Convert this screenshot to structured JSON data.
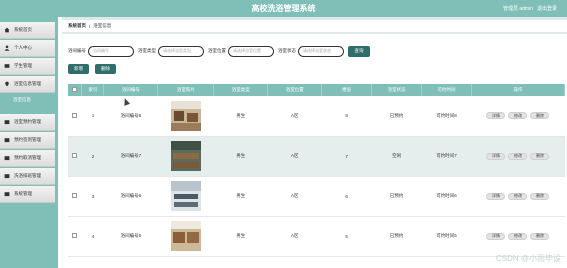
{
  "header": {
    "title": "高校洗浴管理系统",
    "user": "管理员 admin",
    "logout": "退出登录"
  },
  "sidebar": {
    "items": [
      {
        "label": "系统首页",
        "icon": "home-icon"
      },
      {
        "label": "个人中心",
        "icon": "user-icon"
      },
      {
        "label": "学生管理",
        "icon": "students-icon"
      },
      {
        "label": "浴室信息管理",
        "icon": "location-icon",
        "sub": "浴室信息"
      },
      {
        "label": "浴室预约管理",
        "icon": "folder-icon"
      },
      {
        "label": "预约签到管理",
        "icon": "folder-icon"
      },
      {
        "label": "预约取消管理",
        "icon": "folder-icon"
      },
      {
        "label": "洗浴排班管理",
        "icon": "folder-icon"
      },
      {
        "label": "系统管理",
        "icon": "folder-icon"
      }
    ]
  },
  "breadcrumb": {
    "home": "系统首页",
    "sep": "/",
    "current": "浴室信息"
  },
  "search": {
    "fields": [
      {
        "label": "浴间编号",
        "placeholder": "浴间编号"
      },
      {
        "label": "浴室类型",
        "placeholder": "请选择浴室类型"
      },
      {
        "label": "浴室位置",
        "placeholder": "请选择浴室位置"
      },
      {
        "label": "浴室状态",
        "placeholder": "请选择浴室状态"
      }
    ],
    "button": "查询"
  },
  "actions": {
    "add": "新增",
    "delete": "删除"
  },
  "table": {
    "headers": [
      "",
      "索引",
      "浴间编号",
      "浴室照片",
      "浴室类型",
      "浴室位置",
      "楼层",
      "浴室状态",
      "可约时间",
      "操作"
    ],
    "rows": [
      {
        "index": "1",
        "code": "浴间编号8",
        "type": "男生",
        "location": "A区",
        "floor": "8",
        "status": "已预约",
        "time": "可约时间8"
      },
      {
        "index": "2",
        "code": "浴间编号7",
        "type": "男生",
        "location": "A区",
        "floor": "7",
        "status": "空闲",
        "time": "可约时间7"
      },
      {
        "index": "3",
        "code": "浴间编号6",
        "type": "男生",
        "location": "A区",
        "floor": "6",
        "status": "已预约",
        "time": "可约时间6"
      },
      {
        "index": "4",
        "code": "浴间编号5",
        "type": "男生",
        "location": "A区",
        "floor": "5",
        "status": "已预约",
        "time": "可约时间5"
      }
    ],
    "ops": {
      "detail": "详情",
      "edit": "修改",
      "remove": "删除"
    }
  },
  "watermark": "CSDN @小雨毕设",
  "colors": {
    "accent": "#7fbfb8",
    "dark": "#2f6e6a"
  }
}
